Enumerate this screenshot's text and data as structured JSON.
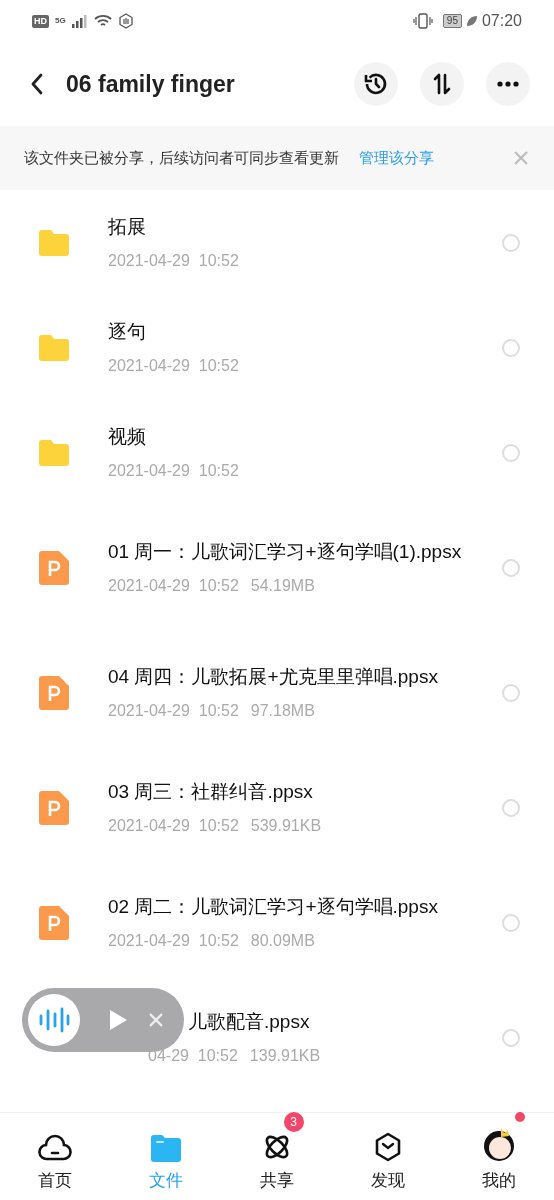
{
  "status_bar": {
    "hd": "HD",
    "network": "5G",
    "battery": "95",
    "time": "07:20"
  },
  "header": {
    "title": "06 family finger"
  },
  "banner": {
    "text": "该文件夹已被分享，后续访问者可同步查看更新",
    "link": "管理该分享"
  },
  "files": [
    {
      "kind": "folder",
      "name": "拓展",
      "date": "2021-04-29  10:52",
      "selected": false
    },
    {
      "kind": "folder",
      "name": "逐句",
      "date": "2021-04-29  10:52",
      "selected": false
    },
    {
      "kind": "folder",
      "name": "视频",
      "date": "2021-04-29  10:52",
      "selected": false
    },
    {
      "kind": "ppt",
      "name": "01 周一：儿歌词汇学习+逐句学唱(1).ppsx",
      "date": "2021-04-29  10:52",
      "size": "54.19MB",
      "selected": false
    },
    {
      "kind": "ppt",
      "name": "04 周四：儿歌拓展+尤克里里弹唱.ppsx",
      "date": "2021-04-29  10:52",
      "size": "97.18MB",
      "selected": false
    },
    {
      "kind": "ppt",
      "name": "03 周三：社群纠音.ppsx",
      "date": "2021-04-29  10:52",
      "size": "539.91KB",
      "selected": false
    },
    {
      "kind": "ppt",
      "name": "02 周二：儿歌词汇学习+逐句学唱.ppsx",
      "date": "2021-04-29  10:52",
      "size": "80.09MB",
      "selected": false
    },
    {
      "kind": "ppt",
      "name": "儿歌配音.ppsx",
      "date": "04-29  10:52",
      "size": "139.91KB",
      "selected": false,
      "covered": true
    }
  ],
  "tabs": [
    {
      "kind": "home",
      "label": "首页",
      "selected": false
    },
    {
      "kind": "files",
      "label": "文件",
      "selected": true
    },
    {
      "kind": "share",
      "label": "共享",
      "selected": false,
      "badge": "3"
    },
    {
      "kind": "discover",
      "label": "发现",
      "selected": false
    },
    {
      "kind": "me",
      "label": "我的",
      "selected": false,
      "dot": true
    }
  ]
}
